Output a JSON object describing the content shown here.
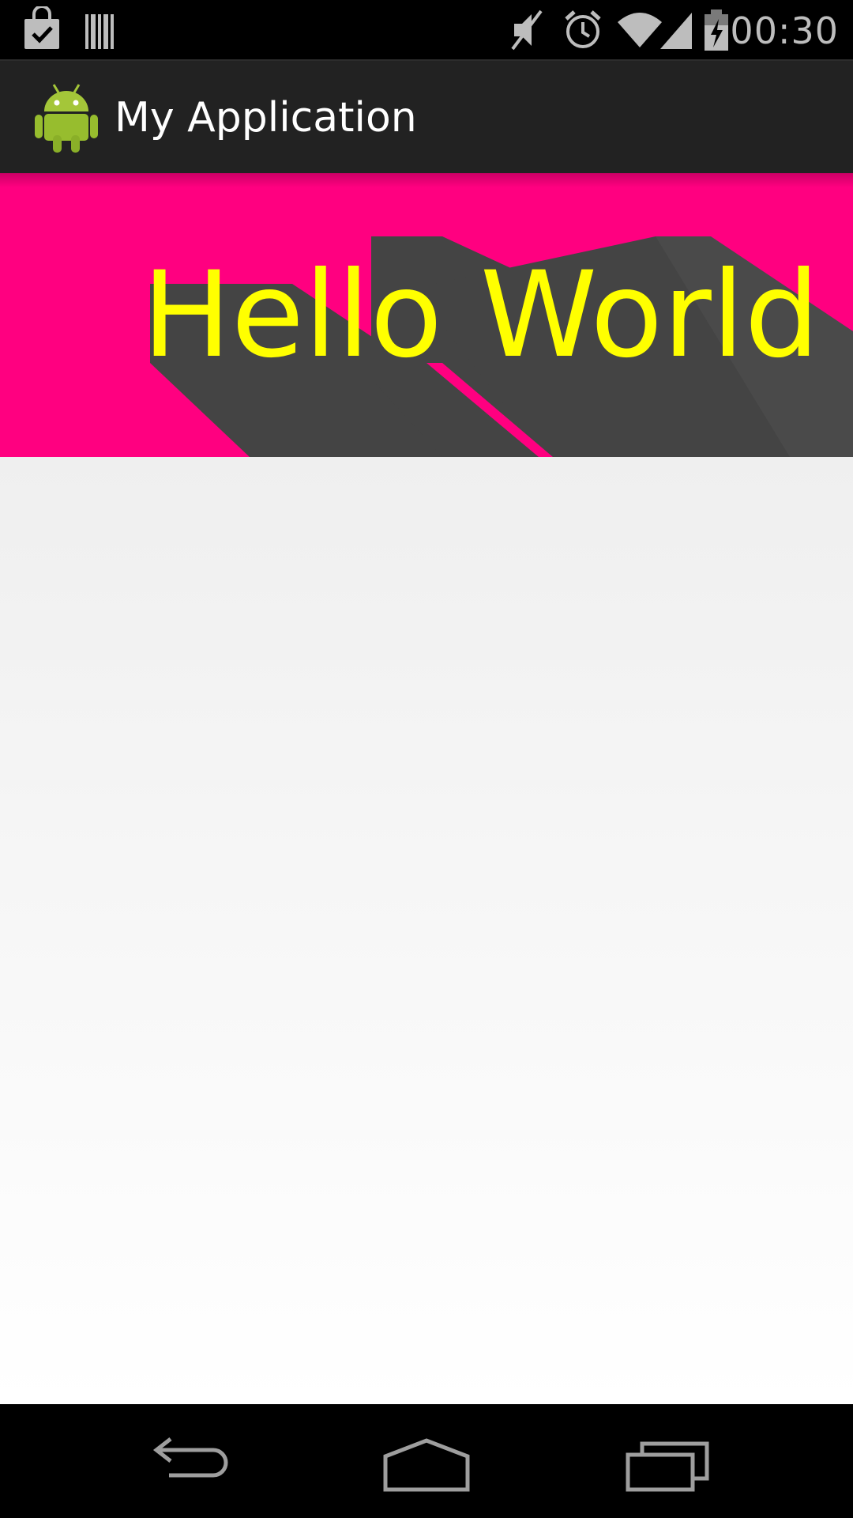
{
  "status_bar": {
    "time": "00:30",
    "icons": [
      "shopping-bag-check-icon",
      "barcode-icon",
      "mute-icon",
      "alarm-icon",
      "wifi-icon",
      "cell-signal-icon",
      "battery-charging-icon"
    ]
  },
  "action_bar": {
    "title": "My Application",
    "app_icon": "android-robot-icon"
  },
  "banner": {
    "text": "Hello World",
    "background_color": "#ff0080",
    "text_color": "#ffff00",
    "shadow_color": "#444444"
  },
  "nav_bar": {
    "buttons": [
      "back-icon",
      "home-icon",
      "recents-icon"
    ]
  }
}
